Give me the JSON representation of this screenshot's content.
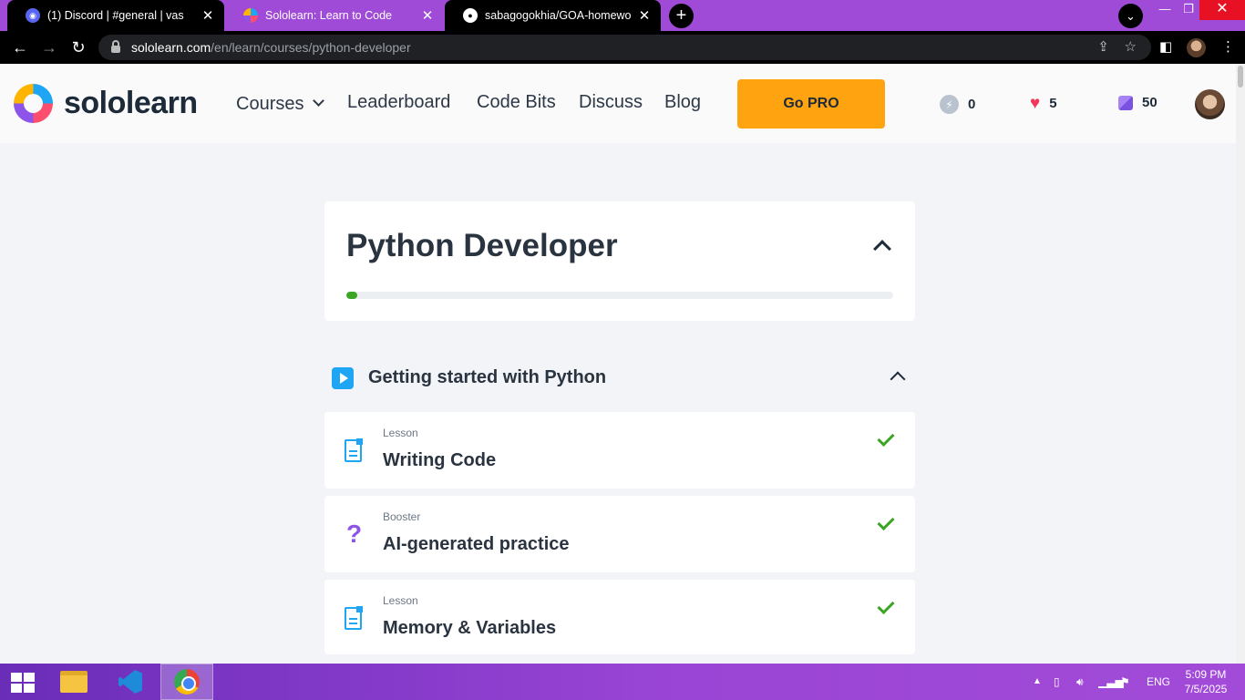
{
  "browser": {
    "tabs": [
      {
        "title": "(1) Discord | #general | vas",
        "active": false
      },
      {
        "title": "Sololearn: Learn to Code",
        "active": true
      },
      {
        "title": "sabagogokhia/GOA-homeworks",
        "active": false
      }
    ],
    "url_host": "sololearn.com",
    "url_path": "/en/learn/courses/python-developer"
  },
  "header": {
    "logo_text": "sololearn",
    "nav": {
      "courses": "Courses",
      "leaderboard": "Leaderboard",
      "code_bits": "Code Bits",
      "discuss": "Discuss",
      "blog": "Blog"
    },
    "go_pro": "Go PRO",
    "streak": "0",
    "hearts": "5",
    "gems": "50"
  },
  "course": {
    "title": "Python Developer",
    "progress_percent": 2
  },
  "module": {
    "title": "Getting started with Python",
    "items": [
      {
        "type": "Lesson",
        "name": "Writing Code",
        "completed": true
      },
      {
        "type": "Booster",
        "name": "AI-generated practice",
        "completed": true
      },
      {
        "type": "Lesson",
        "name": "Memory & Variables",
        "completed": true
      }
    ]
  },
  "taskbar": {
    "language": "ENG",
    "time": "5:09 PM",
    "date": "7/5/2025"
  },
  "colors": {
    "accent_pro": "#ffa310",
    "brand_blue": "#1ea5f3",
    "success_green": "#3aa623",
    "tab_strip": "#a04bd7"
  }
}
